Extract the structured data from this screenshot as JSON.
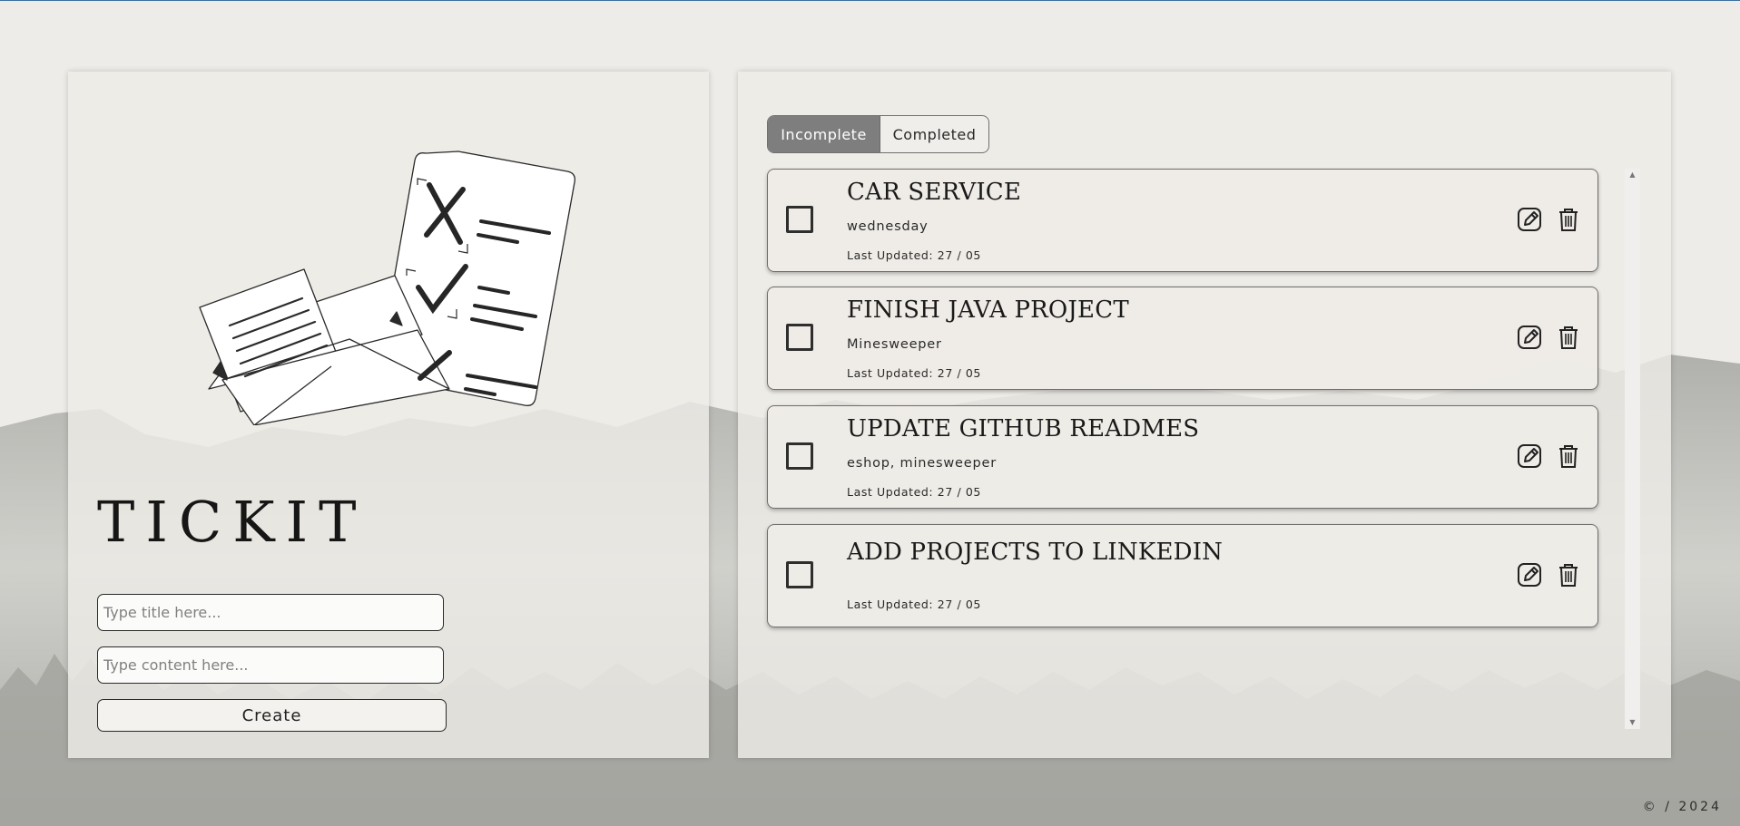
{
  "app": {
    "brand": "TICKIT"
  },
  "form": {
    "title_placeholder": "Type title here...",
    "content_placeholder": "Type content here...",
    "create_label": "Create"
  },
  "tabs": [
    {
      "label": "Incomplete",
      "active": true
    },
    {
      "label": "Completed",
      "active": false
    }
  ],
  "tasks": [
    {
      "title": "CAR SERVICE",
      "content": "wednesday",
      "updated": "Last Updated: 27 / 05",
      "checked": false
    },
    {
      "title": "FINISH JAVA PROJECT",
      "content": "Minesweeper",
      "updated": "Last Updated: 27 / 05",
      "checked": false
    },
    {
      "title": "UPDATE GITHUB READMES",
      "content": "eshop, minesweeper",
      "updated": "Last Updated: 27 / 05",
      "checked": false
    },
    {
      "title": "ADD PROJECTS TO LINKEDIN",
      "content": "",
      "updated": "Last Updated: 27 / 05",
      "checked": false
    }
  ],
  "icons": {
    "edit": "edit-icon",
    "delete": "trash-icon",
    "scroll_up": "scroll-up-arrow",
    "scroll_down": "scroll-down-arrow"
  },
  "footer": {
    "copyright": "© / 2024"
  },
  "colors": {
    "accent": "#7e7e7e",
    "background": "#eeece8",
    "top_border": "#3c6f9f"
  }
}
